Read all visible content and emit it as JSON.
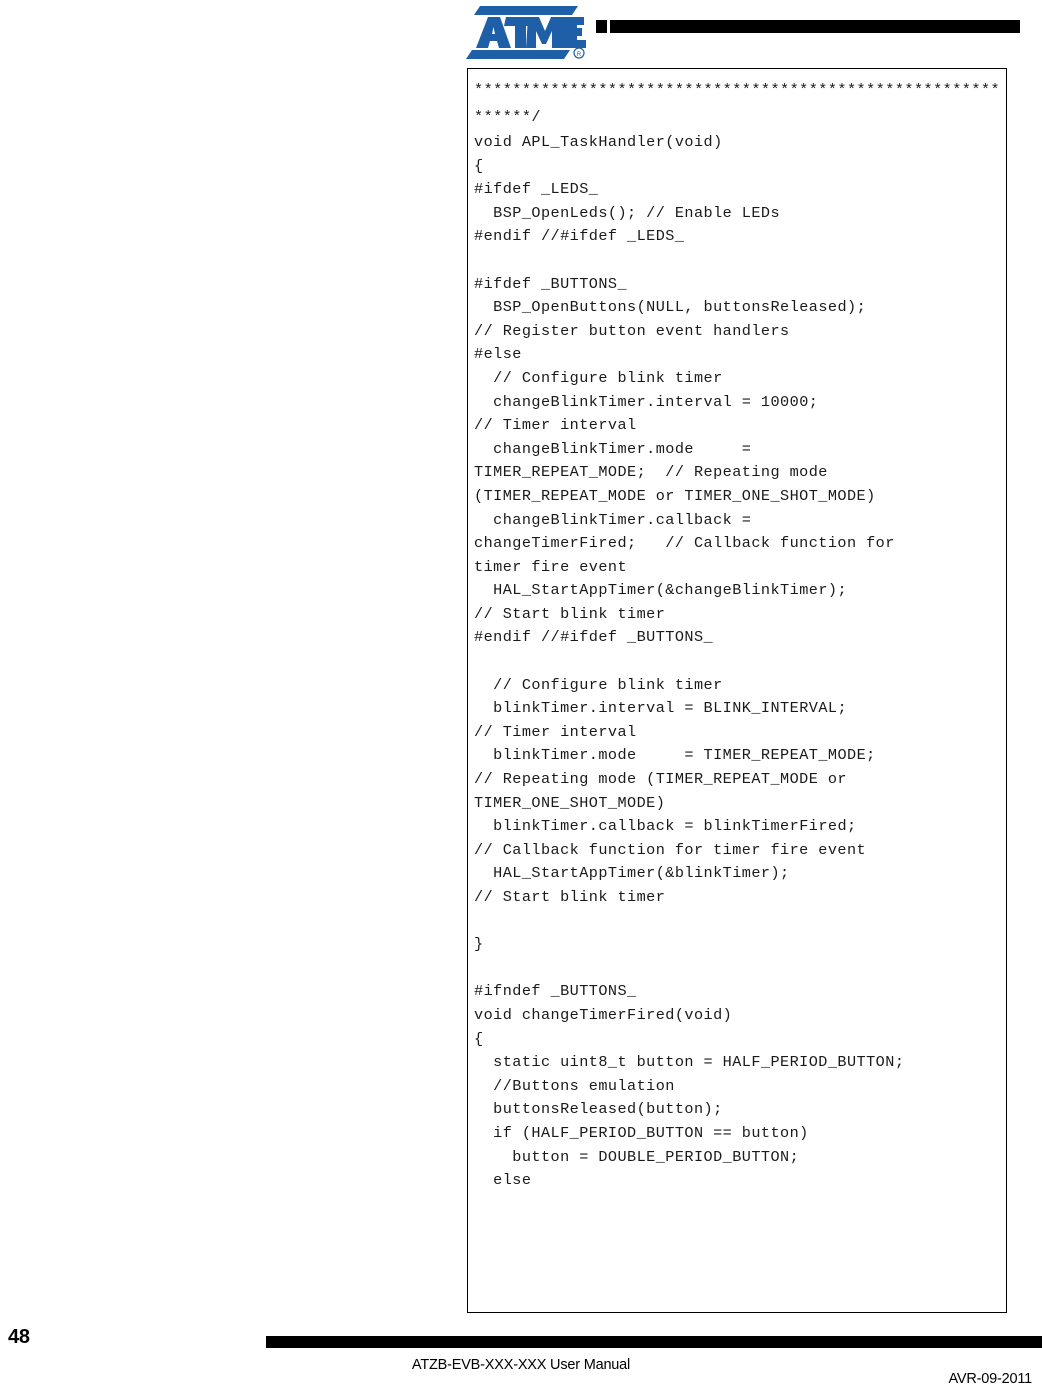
{
  "header": {
    "logo_name": "atmel-logo",
    "logo_text": "ATMEL",
    "logo_registered": "®",
    "logo_color": "#1e5fa8",
    "rule_color": "#000000"
  },
  "code_block": {
    "comment_stars_line1": "************************************************",
    "comment_stars_line2": "*************/",
    "lines": [
      {
        "id": "l01",
        "kind": "stars",
        "text": "*************************************************************/"
      },
      {
        "id": "l02",
        "kind": "line",
        "text": "void APL_TaskHandler(void)"
      },
      {
        "id": "l03",
        "kind": "line",
        "text": "{"
      },
      {
        "id": "l04",
        "kind": "line",
        "text": "#ifdef _LEDS_"
      },
      {
        "id": "l05",
        "kind": "line",
        "text": "  BSP_OpenLeds(); // Enable LEDs"
      },
      {
        "id": "l06",
        "kind": "line",
        "text": "#endif //#ifdef _LEDS_"
      },
      {
        "id": "l07",
        "kind": "blank",
        "text": ""
      },
      {
        "id": "l08",
        "kind": "line",
        "text": "#ifdef _BUTTONS_"
      },
      {
        "id": "l09",
        "kind": "para",
        "text": "  BSP_OpenButtons(NULL, buttonsReleased);\n// Register button event handlers"
      },
      {
        "id": "l10",
        "kind": "line",
        "text": "#else"
      },
      {
        "id": "l11",
        "kind": "line",
        "text": "  // Configure blink timer"
      },
      {
        "id": "l12",
        "kind": "para",
        "text": "  changeBlinkTimer.interval = 10000;\n// Timer interval"
      },
      {
        "id": "l13",
        "kind": "para",
        "text": "  changeBlinkTimer.mode     =\nTIMER_REPEAT_MODE;  // Repeating mode\n(TIMER_REPEAT_MODE or TIMER_ONE_SHOT_MODE)"
      },
      {
        "id": "l14",
        "kind": "para",
        "text": "  changeBlinkTimer.callback =\nchangeTimerFired;   // Callback function for\ntimer fire event"
      },
      {
        "id": "l15",
        "kind": "para",
        "text": "  HAL_StartAppTimer(&changeBlinkTimer);\n// Start blink timer"
      },
      {
        "id": "l16",
        "kind": "line",
        "text": "#endif //#ifdef _BUTTONS_"
      },
      {
        "id": "l17",
        "kind": "blank",
        "text": ""
      },
      {
        "id": "l18",
        "kind": "line",
        "text": "  // Configure blink timer"
      },
      {
        "id": "l19",
        "kind": "para",
        "text": "  blinkTimer.interval = BLINK_INTERVAL;\n// Timer interval"
      },
      {
        "id": "l20",
        "kind": "para",
        "text": "  blinkTimer.mode     = TIMER_REPEAT_MODE;\n// Repeating mode (TIMER_REPEAT_MODE or\nTIMER_ONE_SHOT_MODE)"
      },
      {
        "id": "l21",
        "kind": "para",
        "text": "  blinkTimer.callback = blinkTimerFired;\n// Callback function for timer fire event"
      },
      {
        "id": "l22",
        "kind": "para",
        "text": "  HAL_StartAppTimer(&blinkTimer);\n// Start blink timer"
      },
      {
        "id": "l23",
        "kind": "blank",
        "text": ""
      },
      {
        "id": "l24",
        "kind": "line",
        "text": "}"
      },
      {
        "id": "l25",
        "kind": "blank",
        "text": ""
      },
      {
        "id": "l26",
        "kind": "line",
        "text": "#ifndef _BUTTONS_"
      },
      {
        "id": "l27",
        "kind": "line",
        "text": "void changeTimerFired(void)"
      },
      {
        "id": "l28",
        "kind": "line",
        "text": "{"
      },
      {
        "id": "l29",
        "kind": "line",
        "text": "  static uint8_t button = HALF_PERIOD_BUTTON;"
      },
      {
        "id": "l30",
        "kind": "line",
        "text": "  //Buttons emulation"
      },
      {
        "id": "l31",
        "kind": "line",
        "text": "  buttonsReleased(button);"
      },
      {
        "id": "l32",
        "kind": "line",
        "text": "  if (HALF_PERIOD_BUTTON == button)"
      },
      {
        "id": "l33",
        "kind": "line",
        "text": "    button = DOUBLE_PERIOD_BUTTON;"
      },
      {
        "id": "l34",
        "kind": "line",
        "text": "  else"
      }
    ]
  },
  "footer": {
    "page_number": "48",
    "title": "ATZB-EVB-XXX-XXX User Manual",
    "doc_code": "AVR-09-2011",
    "rule_color": "#000000"
  }
}
